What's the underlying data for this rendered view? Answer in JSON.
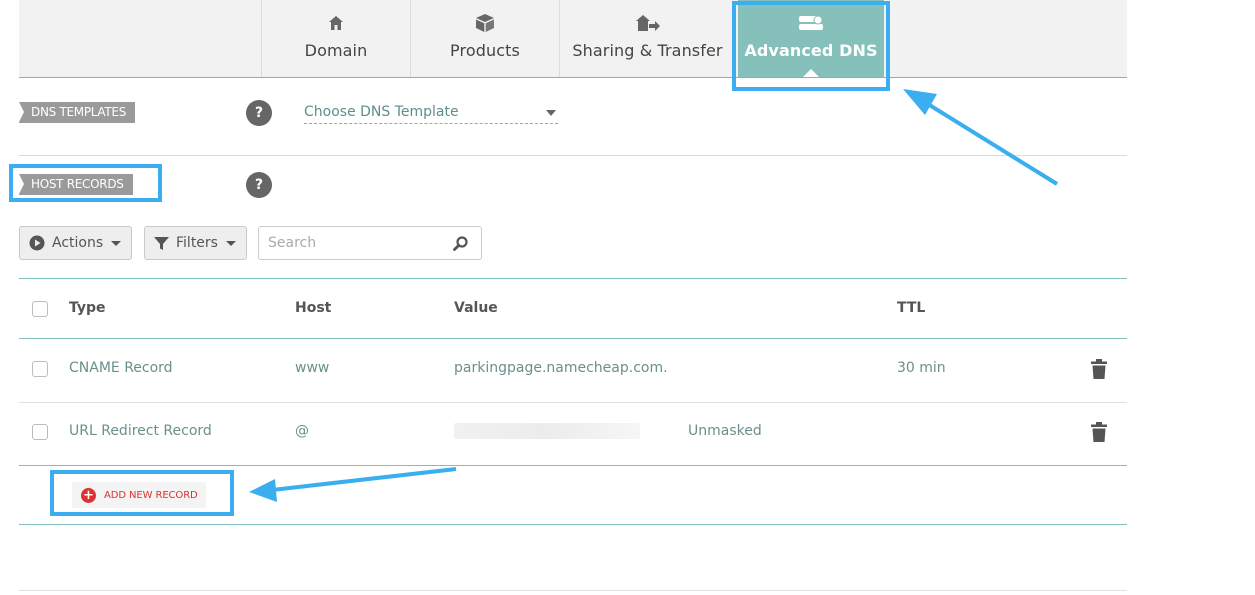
{
  "tabs": [
    {
      "label": "Domain",
      "icon": "home-icon",
      "active": false
    },
    {
      "label": "Products",
      "icon": "box-icon",
      "active": false
    },
    {
      "label": "Sharing & Transfer",
      "icon": "share-transfer-icon",
      "active": false
    },
    {
      "label": "Advanced DNS",
      "icon": "dns-server-icon",
      "active": true
    }
  ],
  "dns_templates": {
    "flag": "DNS TEMPLATES",
    "help": "?",
    "select_value": "Choose DNS Template"
  },
  "host_records": {
    "flag": "HOST RECORDS",
    "help": "?"
  },
  "toolbar": {
    "actions_label": "Actions",
    "filters_label": "Filters",
    "search_placeholder": "Search"
  },
  "table": {
    "headers": {
      "type": "Type",
      "host": "Host",
      "value": "Value",
      "ttl": "TTL"
    },
    "rows": [
      {
        "type": "CNAME Record",
        "host": "www",
        "value": "parkingpage.namecheap.com.",
        "extra": "",
        "ttl": "30 min"
      },
      {
        "type": "URL Redirect Record",
        "host": "@",
        "value": "",
        "extra": "Unmasked",
        "ttl": ""
      }
    ]
  },
  "add_record_label": "ADD NEW RECORD",
  "colors": {
    "accent_teal": "#86c0bb",
    "highlight_blue": "#3aaeee",
    "add_red": "#e0312f"
  }
}
